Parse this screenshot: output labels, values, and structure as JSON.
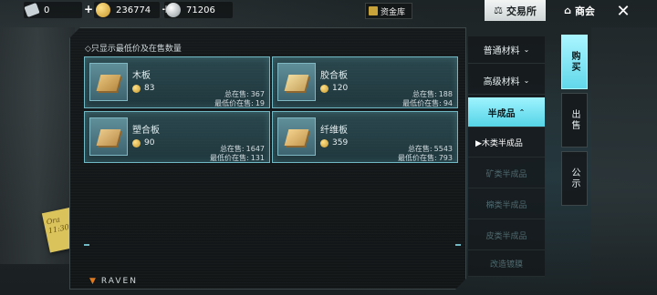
{
  "topbar": {
    "currencies": [
      {
        "icon": "ticket-icon",
        "value": "0"
      },
      {
        "icon": "gold-coin-icon",
        "value": "236774"
      },
      {
        "icon": "silver-coin-icon",
        "value": "71206"
      }
    ],
    "vault_label": "资金库",
    "exchange_label": "交易所",
    "shop_label": "商会"
  },
  "panel": {
    "filter_label": "只显示最低价及在售数量",
    "items": [
      {
        "name": "木板",
        "price": "83",
        "total_label": "总在售:",
        "total": "367",
        "min_label": "最低价在售:",
        "min": "19"
      },
      {
        "name": "胶合板",
        "price": "120",
        "total_label": "总在售:",
        "total": "188",
        "min_label": "最低价在售:",
        "min": "94"
      },
      {
        "name": "塑合板",
        "price": "90",
        "total_label": "总在售:",
        "total": "1647",
        "min_label": "最低价在售:",
        "min": "131"
      },
      {
        "name": "纤维板",
        "price": "359",
        "total_label": "总在售:",
        "total": "5543",
        "min_label": "最低价在售:",
        "min": "793"
      }
    ],
    "brand": "RAVEN"
  },
  "categories": {
    "items": [
      {
        "label": "普通材料",
        "arrow": "⌄"
      },
      {
        "label": "高级材料",
        "arrow": "⌄"
      },
      {
        "label": "半成品",
        "arrow": "⌃"
      }
    ],
    "subitems": [
      "▶木类半成品",
      "矿类半成品",
      "棉类半成品",
      "皮类半成品",
      "改造镀膜"
    ]
  },
  "side_tabs": [
    "购买",
    "出售",
    "公示"
  ],
  "sticky_note": "Ora\n11:30"
}
